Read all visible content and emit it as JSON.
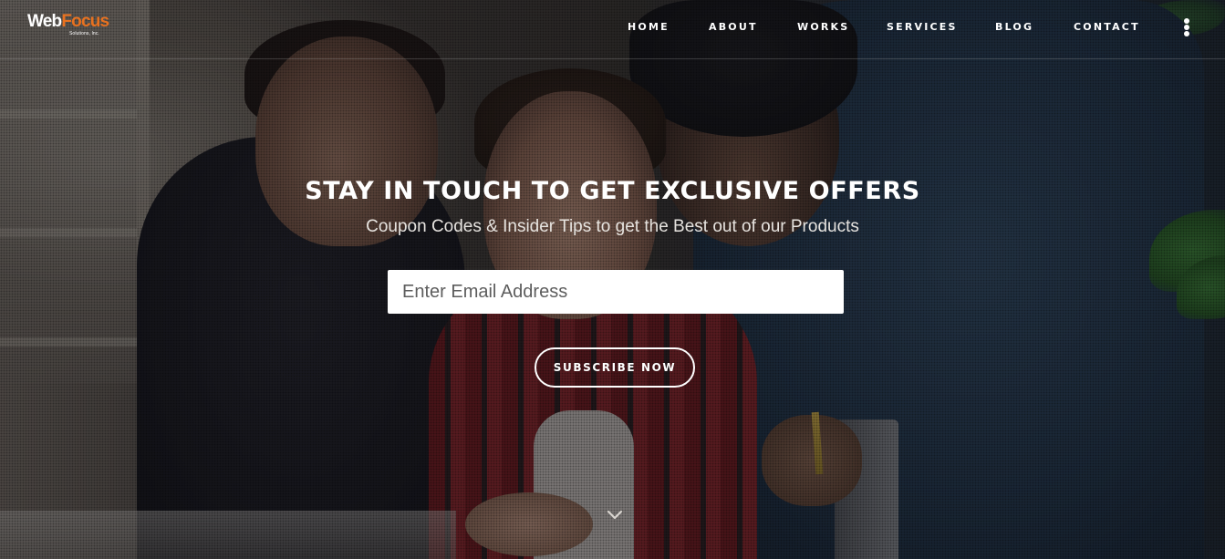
{
  "logo": {
    "web": "Web",
    "focus": "Focus",
    "subtitle": "Solutions, Inc."
  },
  "nav": {
    "items": [
      {
        "label": "HOME"
      },
      {
        "label": "ABOUT"
      },
      {
        "label": "WORKS"
      },
      {
        "label": "SERVICES"
      },
      {
        "label": "BLOG"
      },
      {
        "label": "CONTACT"
      }
    ],
    "menu_icon": "vertical-ellipsis-icon"
  },
  "hero": {
    "title": "STAY IN TOUCH TO GET EXCLUSIVE OFFERS",
    "subtitle": "Coupon Codes & Insider Tips to get the Best out of our Products",
    "email_input": {
      "value": "",
      "placeholder": "Enter Email Address"
    },
    "subscribe_label": "SUBSCRIBE NOW",
    "scroll_icon": "chevron-down-icon"
  },
  "colors": {
    "brand_orange": "#e8711f",
    "text_white": "#ffffff"
  }
}
